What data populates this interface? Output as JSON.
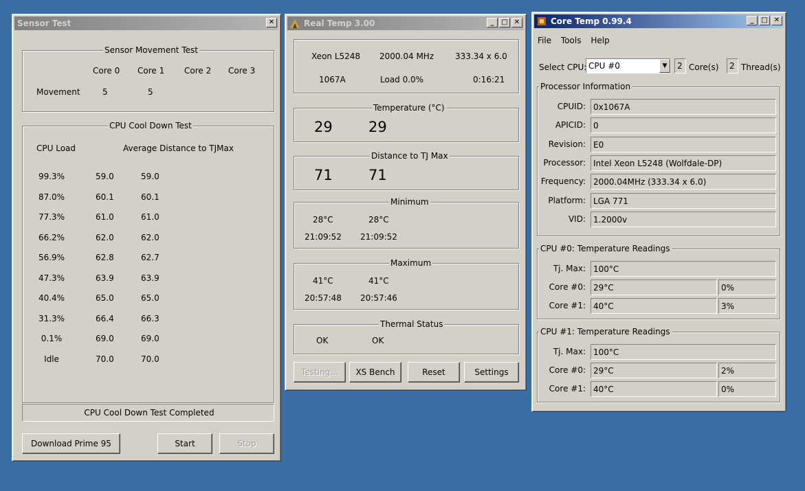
{
  "sensor": {
    "title": "Sensor Test",
    "movement_group": "Sensor Movement Test",
    "core_headers": [
      "Core 0",
      "Core 1",
      "Core 2",
      "Core 3"
    ],
    "movement_label": "Movement",
    "movement_values": [
      "5",
      "5"
    ],
    "cooldown_group": "CPU Cool Down Test",
    "cpu_load_header": "CPU Load",
    "avg_header": "Average Distance to TJMax",
    "rows": [
      [
        "99.3%",
        "59.0",
        "59.0"
      ],
      [
        "87.0%",
        "60.1",
        "60.1"
      ],
      [
        "77.3%",
        "61.0",
        "61.0"
      ],
      [
        "66.2%",
        "62.0",
        "62.0"
      ],
      [
        "56.9%",
        "62.8",
        "62.7"
      ],
      [
        "47.3%",
        "63.9",
        "63.9"
      ],
      [
        "40.4%",
        "65.0",
        "65.0"
      ],
      [
        "31.3%",
        "66.4",
        "66.3"
      ],
      [
        "0.1%",
        "69.0",
        "69.0"
      ],
      [
        "Idle",
        "70.0",
        "70.0"
      ]
    ],
    "status": "CPU Cool Down Test Completed",
    "download_btn": "Download Prime 95",
    "start_btn": "Start",
    "stop_btn": "Stop"
  },
  "realtemp": {
    "title": "Real Temp 3.00",
    "cpu_name": "Xeon L5248",
    "freq": "2000.04 MHz",
    "mult": "333.34 x 6.0",
    "stepping": "1067A",
    "load": "Load  0.0%",
    "time": "0:16:21",
    "temp_group": "Temperature (°C)",
    "temps": [
      "29",
      "29"
    ],
    "dist_group": "Distance to TJ Max",
    "dists": [
      "71",
      "71"
    ],
    "min_group": "Minimum",
    "min_temps": [
      "28°C",
      "28°C"
    ],
    "min_times": [
      "21:09:52",
      "21:09:52"
    ],
    "max_group": "Maximum",
    "max_temps": [
      "41°C",
      "41°C"
    ],
    "max_times": [
      "20:57:48",
      "20:57:46"
    ],
    "thermal_group": "Thermal Status",
    "thermal": [
      "OK",
      "OK"
    ],
    "testing_btn": "Testing...",
    "xsbench_btn": "XS Bench",
    "reset_btn": "Reset",
    "settings_btn": "Settings"
  },
  "coretemp": {
    "title": "Core Temp 0.99.4",
    "menu": [
      "File",
      "Tools",
      "Help"
    ],
    "select_cpu_label": "Select CPU:",
    "select_cpu_value": "CPU #0",
    "cores_count": "2",
    "cores_label": "Core(s)",
    "threads_count": "2",
    "threads_label": "Thread(s)",
    "proc_group": "Processor Information",
    "proc_labels": [
      "CPUID:",
      "APICID:",
      "Revision:",
      "Processor:",
      "Frequency:",
      "Platform:",
      "VID:"
    ],
    "proc_values": [
      "0x1067A",
      "0",
      "E0",
      "Intel Xeon L5248 (Wolfdale-DP)",
      "2000.04MHz (333.34 x 6.0)",
      "LGA 771",
      "1.2000v"
    ],
    "cpu0_group": "CPU #0: Temperature Readings",
    "cpu0_tjmax_label": "Tj. Max:",
    "cpu0_tjmax": "100°C",
    "cpu0_core_labels": [
      "Core #0:",
      "Core #1:"
    ],
    "cpu0_core_temps": [
      "29°C",
      "40°C"
    ],
    "cpu0_core_loads": [
      "0%",
      "3%"
    ],
    "cpu1_group": "CPU #1: Temperature Readings",
    "cpu1_tjmax_label": "Tj. Max:",
    "cpu1_tjmax": "100°C",
    "cpu1_core_labels": [
      "Core #0:",
      "Core #1:"
    ],
    "cpu1_core_temps": [
      "29°C",
      "40°C"
    ],
    "cpu1_core_loads": [
      "2%",
      "0%"
    ]
  },
  "colors": {
    "desktop": "#3a6ea5",
    "window_face": "#d4d0c8",
    "active_title": "#0a246a",
    "inactive_title": "#808080"
  }
}
